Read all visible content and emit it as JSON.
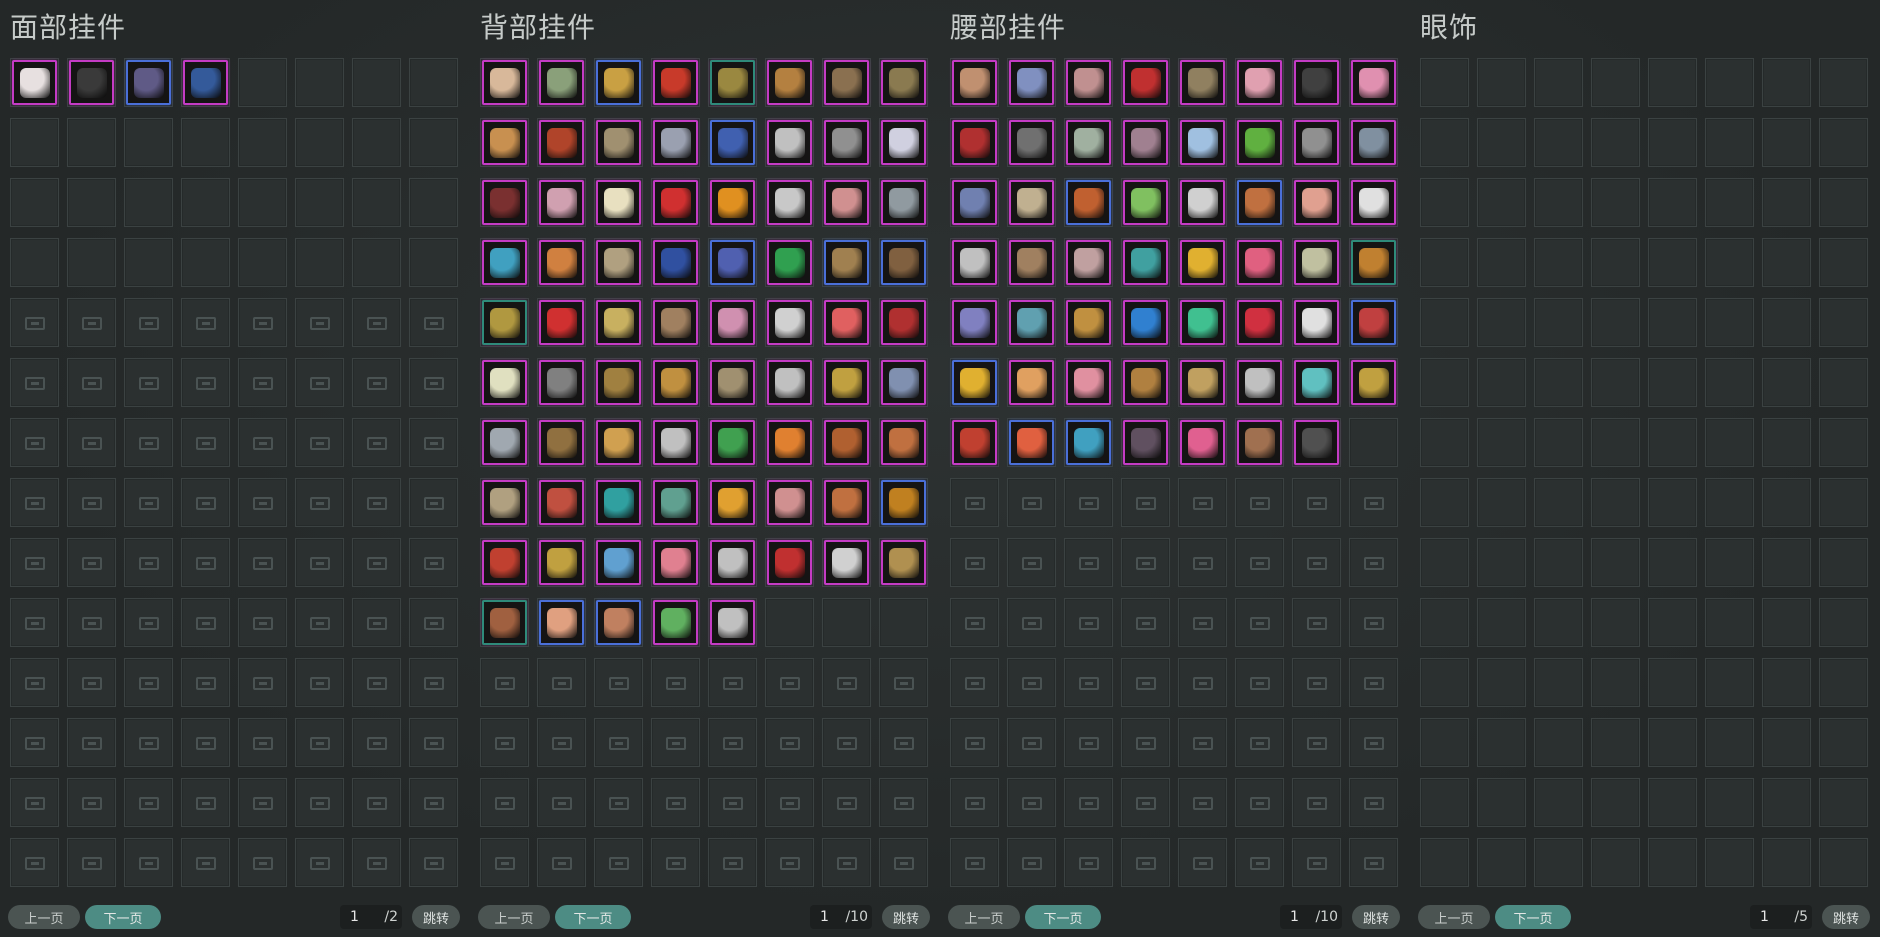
{
  "panels": [
    {
      "id": "face",
      "title": "面部挂件",
      "open_slots": 32,
      "items": [
        {
          "icon": "mask-icon",
          "c": "#e7e0e0",
          "b": "pink"
        },
        {
          "icon": "black-veil-icon",
          "c": "#3a3a3a",
          "b": "pink"
        },
        {
          "icon": "dark-wing-mask-icon",
          "c": "#5f5a86",
          "b": "blue"
        },
        {
          "icon": "blue-bird-mask-icon",
          "c": "#345a9a",
          "b": "pink"
        }
      ],
      "pager": {
        "prev": "上一页",
        "next": "下一页",
        "page": "1",
        "total": "/2",
        "jump": "跳转"
      }
    },
    {
      "id": "back",
      "title": "背部挂件",
      "open_slots": 80,
      "items": [
        {
          "icon": "doll-icon",
          "c": "#d8b89a",
          "b": "pink"
        },
        {
          "icon": "snake-ring-icon",
          "c": "#8aa07a",
          "b": "pink"
        },
        {
          "icon": "golden-bow-icon",
          "c": "#c9a043",
          "b": "blue"
        },
        {
          "icon": "parrot-icon",
          "c": "#c83a2a",
          "b": "pink"
        },
        {
          "icon": "woven-fan-icon",
          "c": "#9a8840",
          "b": "teal"
        },
        {
          "icon": "drum-icon",
          "c": "#b48040",
          "b": "pink"
        },
        {
          "icon": "branch-icon",
          "c": "#8a7050",
          "b": "pink"
        },
        {
          "icon": "crossbow-icon",
          "c": "#8a7a50",
          "b": "pink"
        },
        {
          "icon": "lantern-icon",
          "c": "#c89050",
          "b": "pink"
        },
        {
          "icon": "monkey-icon",
          "c": "#b0442a",
          "b": "pink"
        },
        {
          "icon": "spear-icon",
          "c": "#a09070",
          "b": "pink"
        },
        {
          "icon": "fan-icon",
          "c": "#9aa0b0",
          "b": "pink"
        },
        {
          "icon": "blue-globe-icon",
          "c": "#4060b0",
          "b": "blue"
        },
        {
          "icon": "flute-icon",
          "c": "#c0c0c0",
          "b": "pink"
        },
        {
          "icon": "totem-icon",
          "c": "#909090",
          "b": "pink"
        },
        {
          "icon": "crane-icon",
          "c": "#d0d0e0",
          "b": "pink"
        },
        {
          "icon": "bead-string-icon",
          "c": "#7a3030",
          "b": "pink"
        },
        {
          "icon": "flower-branch-icon",
          "c": "#d0a0b0",
          "b": "pink"
        },
        {
          "icon": "pearl-icon",
          "c": "#e8e0c0",
          "b": "pink"
        },
        {
          "icon": "red-leaf-icon",
          "c": "#d03030",
          "b": "pink"
        },
        {
          "icon": "pentagram-icon",
          "c": "#e09020",
          "b": "pink"
        },
        {
          "icon": "white-bird-icon",
          "c": "#c8c8c8",
          "b": "pink"
        },
        {
          "icon": "wind-chime-icon",
          "c": "#d09090",
          "b": "pink"
        },
        {
          "icon": "stone-disc-icon",
          "c": "#909aa0",
          "b": "pink"
        },
        {
          "icon": "kingfisher-icon",
          "c": "#40a0c0",
          "b": "pink"
        },
        {
          "icon": "parasol-icon",
          "c": "#d08040",
          "b": "pink"
        },
        {
          "icon": "lamp-icon",
          "c": "#b0a080",
          "b": "pink"
        },
        {
          "icon": "shrine-icon",
          "c": "#3050a0",
          "b": "pink"
        },
        {
          "icon": "swirl-orb-icon",
          "c": "#5060b0",
          "b": "blue"
        },
        {
          "icon": "jade-cabinet-icon",
          "c": "#30a050",
          "b": "pink"
        },
        {
          "icon": "scroll-case-icon",
          "c": "#a08050",
          "b": "blue"
        },
        {
          "icon": "barrel-icon",
          "c": "#806040",
          "b": "blue"
        },
        {
          "icon": "straw-hat-icon",
          "c": "#b09840",
          "b": "teal"
        },
        {
          "icon": "red-feather-icon",
          "c": "#d03030",
          "b": "pink"
        },
        {
          "icon": "golden-shield-icon",
          "c": "#c8b060",
          "b": "pink"
        },
        {
          "icon": "dagger-icon",
          "c": "#a08060",
          "b": "pink"
        },
        {
          "icon": "blossom-icon",
          "c": "#d090b0",
          "b": "pink"
        },
        {
          "icon": "mirror-icon",
          "c": "#d0d0d0",
          "b": "pink"
        },
        {
          "icon": "peach-icon",
          "c": "#e06060",
          "b": "pink"
        },
        {
          "icon": "red-branch-icon",
          "c": "#b03030",
          "b": "pink"
        },
        {
          "icon": "tablet-icon",
          "c": "#e0e0c0",
          "b": "pink"
        },
        {
          "icon": "black-sword-icon",
          "c": "#808080",
          "b": "pink"
        },
        {
          "icon": "spotted-bow-icon",
          "c": "#a08040",
          "b": "pink"
        },
        {
          "icon": "golden-monkey-icon",
          "c": "#c09040",
          "b": "pink"
        },
        {
          "icon": "gourd-icon",
          "c": "#a09070",
          "b": "pink"
        },
        {
          "icon": "orb-staff-icon",
          "c": "#c0c0c0",
          "b": "pink"
        },
        {
          "icon": "golden-dragon-icon",
          "c": "#c0a040",
          "b": "pink"
        },
        {
          "icon": "blue-blade-icon",
          "c": "#8090b0",
          "b": "pink"
        },
        {
          "icon": "steel-sword-icon",
          "c": "#a0a8b0",
          "b": "pink"
        },
        {
          "icon": "tent-icon",
          "c": "#907040",
          "b": "pink"
        },
        {
          "icon": "golden-fish-icon",
          "c": "#d0a050",
          "b": "pink"
        },
        {
          "icon": "plum-branch-icon",
          "c": "#c0c0c0",
          "b": "pink"
        },
        {
          "icon": "jade-spear-icon",
          "c": "#40a050",
          "b": "pink"
        },
        {
          "icon": "fire-wheel-icon",
          "c": "#e08030",
          "b": "pink"
        },
        {
          "icon": "horn-icon",
          "c": "#b06030",
          "b": "pink"
        },
        {
          "icon": "bronze-vase-icon",
          "c": "#c07040",
          "b": "pink"
        },
        {
          "icon": "toad-icon",
          "c": "#b0a080",
          "b": "pink"
        },
        {
          "icon": "girl-icon",
          "c": "#c05040",
          "b": "pink"
        },
        {
          "icon": "teal-sword-icon",
          "c": "#30a0a0",
          "b": "pink"
        },
        {
          "icon": "serpent-icon",
          "c": "#60a090",
          "b": "pink"
        },
        {
          "icon": "sun-disc-icon",
          "c": "#e0a030",
          "b": "pink"
        },
        {
          "icon": "paper-fan-icon",
          "c": "#d09090",
          "b": "pink"
        },
        {
          "icon": "kite-icon",
          "c": "#c07040",
          "b": "pink"
        },
        {
          "icon": "golden-hook-icon",
          "c": "#c08020",
          "b": "blue"
        },
        {
          "icon": "fortune-god-icon",
          "c": "#c04030",
          "b": "pink"
        },
        {
          "icon": "trident-icon",
          "c": "#c0a040",
          "b": "pink"
        },
        {
          "icon": "ice-globe-icon",
          "c": "#60a0d0",
          "b": "pink"
        },
        {
          "icon": "flower-basket-icon",
          "c": "#e08090",
          "b": "pink"
        },
        {
          "icon": "silver-dragon-icon",
          "c": "#c0c0c0",
          "b": "pink"
        },
        {
          "icon": "gift-box-icon",
          "c": "#c03030",
          "b": "pink"
        },
        {
          "icon": "pipa-icon",
          "c": "#d0d0d0",
          "b": "pink"
        },
        {
          "icon": "bamboo-icon",
          "c": "#b09050",
          "b": "pink"
        },
        {
          "icon": "backpack-icon",
          "c": "#a06040",
          "b": "teal"
        },
        {
          "icon": "boy-icon",
          "c": "#e0a080",
          "b": "blue"
        },
        {
          "icon": "baby-icon",
          "c": "#c08060",
          "b": "blue"
        },
        {
          "icon": "green-goblin-icon",
          "c": "#60b060",
          "b": "pink"
        },
        {
          "icon": "sickle-icon",
          "c": "#c0c0c0",
          "b": "pink"
        }
      ],
      "pager": {
        "prev": "上一页",
        "next": "下一页",
        "page": "1",
        "total": "/10",
        "jump": "跳转"
      }
    },
    {
      "id": "waist",
      "title": "腰部挂件",
      "open_slots": 56,
      "items": [
        {
          "icon": "tiger-plush-icon",
          "c": "#c09070",
          "b": "pink"
        },
        {
          "icon": "crossed-swords-icon",
          "c": "#8090c0",
          "b": "pink"
        },
        {
          "icon": "pouch-icon",
          "c": "#c09090",
          "b": "pink"
        },
        {
          "icon": "red-knot-icon",
          "c": "#c03030",
          "b": "pink"
        },
        {
          "icon": "owl-icon",
          "c": "#908060",
          "b": "pink"
        },
        {
          "icon": "rose-icon",
          "c": "#e0a0b0",
          "b": "pink"
        },
        {
          "icon": "dark-charm-icon",
          "c": "#404040",
          "b": "pink"
        },
        {
          "icon": "cherry-branch-icon",
          "c": "#e090b0",
          "b": "pink"
        },
        {
          "icon": "tassel-icon",
          "c": "#b03030",
          "b": "pink"
        },
        {
          "icon": "short-sword-icon",
          "c": "#707070",
          "b": "pink"
        },
        {
          "icon": "jade-pendant-icon",
          "c": "#a0b0a0",
          "b": "pink"
        },
        {
          "icon": "stone-icon",
          "c": "#a08090",
          "b": "pink"
        },
        {
          "icon": "ice-claw-icon",
          "c": "#a0c0e0",
          "b": "pink"
        },
        {
          "icon": "clover-icon",
          "c": "#60b040",
          "b": "pink"
        },
        {
          "icon": "belt-icon",
          "c": "#909090",
          "b": "pink"
        },
        {
          "icon": "armor-icon",
          "c": "#8090a0",
          "b": "pink"
        },
        {
          "icon": "charm-bag-icon",
          "c": "#7080b0",
          "b": "pink"
        },
        {
          "icon": "bell-icon",
          "c": "#c0b090",
          "b": "pink"
        },
        {
          "icon": "wine-jar-icon",
          "c": "#c06030",
          "b": "blue"
        },
        {
          "icon": "green-spoon-icon",
          "c": "#80c060",
          "b": "pink"
        },
        {
          "icon": "hairpin-icon",
          "c": "#d0d0d0",
          "b": "pink"
        },
        {
          "icon": "flute-pair-icon",
          "c": "#c07040",
          "b": "blue"
        },
        {
          "icon": "pig-face-icon",
          "c": "#e0a090",
          "b": "pink"
        },
        {
          "icon": "white-flower-icon",
          "c": "#e0e0e0",
          "b": "pink"
        },
        {
          "icon": "scissors-icon",
          "c": "#c0c0c0",
          "b": "pink"
        },
        {
          "icon": "brush-icon",
          "c": "#a08060",
          "b": "pink"
        },
        {
          "icon": "bead-chain-icon",
          "c": "#c0a0a0",
          "b": "pink"
        },
        {
          "icon": "jade-tag-icon",
          "c": "#40a0a0",
          "b": "pink"
        },
        {
          "icon": "gold-ingot-icon",
          "c": "#e0b030",
          "b": "pink"
        },
        {
          "icon": "peony-icon",
          "c": "#e06080",
          "b": "pink"
        },
        {
          "icon": "crane-feather-icon",
          "c": "#c0c0a0",
          "b": "pink"
        },
        {
          "icon": "jade-bracelet-icon",
          "c": "#c08030",
          "b": "teal"
        },
        {
          "icon": "fairy-icon",
          "c": "#8080c0",
          "b": "pink"
        },
        {
          "icon": "spirit-icon",
          "c": "#60a0b0",
          "b": "pink"
        },
        {
          "icon": "phoenix-icon",
          "c": "#c09040",
          "b": "pink"
        },
        {
          "icon": "sapphire-icon",
          "c": "#3080d0",
          "b": "pink"
        },
        {
          "icon": "jade-ring-icon",
          "c": "#40c090",
          "b": "pink"
        },
        {
          "icon": "ruby-pendant-icon",
          "c": "#d03040",
          "b": "pink"
        },
        {
          "icon": "white-fur-icon",
          "c": "#e0e0e0",
          "b": "pink"
        },
        {
          "icon": "red-jade-icon",
          "c": "#c04040",
          "b": "blue"
        },
        {
          "icon": "gold-boat-icon",
          "c": "#e0b030",
          "b": "blue"
        },
        {
          "icon": "hamster-icon",
          "c": "#e0a060",
          "b": "pink"
        },
        {
          "icon": "piglet-icon",
          "c": "#e090a0",
          "b": "pink"
        },
        {
          "icon": "wooden-box-icon",
          "c": "#b08040",
          "b": "pink"
        },
        {
          "icon": "snail-icon",
          "c": "#c0a060",
          "b": "pink"
        },
        {
          "icon": "silver-hook-icon",
          "c": "#c0c0c0",
          "b": "pink"
        },
        {
          "icon": "crystal-cluster-icon",
          "c": "#60c0c0",
          "b": "pink"
        },
        {
          "icon": "golden-key-icon",
          "c": "#c0a040",
          "b": "pink"
        },
        {
          "icon": "scroll-icon",
          "c": "#c04030",
          "b": "pink"
        },
        {
          "icon": "koi-icon",
          "c": "#e06040",
          "b": "blue"
        },
        {
          "icon": "blue-fish-icon",
          "c": "#40a0c0",
          "b": "blue"
        },
        {
          "icon": "dark-shrine-icon",
          "c": "#605060",
          "b": "pink"
        },
        {
          "icon": "pink-shell-icon",
          "c": "#e06090",
          "b": "pink"
        },
        {
          "icon": "wooden-idol-icon",
          "c": "#a07050",
          "b": "pink"
        },
        {
          "icon": "black-blade-icon",
          "c": "#505050",
          "b": "pink"
        }
      ],
      "pager": {
        "prev": "上一页",
        "next": "下一页",
        "page": "1",
        "total": "/10",
        "jump": "跳转"
      }
    },
    {
      "id": "eye",
      "title": "眼饰",
      "open_slots": 112,
      "items": [],
      "pager": {
        "prev": "上一页",
        "next": "下一页",
        "page": "1",
        "total": "/5",
        "jump": "跳转"
      }
    }
  ],
  "colors": {
    "pink_border": "#c43bc4",
    "blue_border": "#4a6fd8",
    "teal_border": "#2f8a7a",
    "next_button": "#4d8c84",
    "prev_button": "#4b5452"
  }
}
